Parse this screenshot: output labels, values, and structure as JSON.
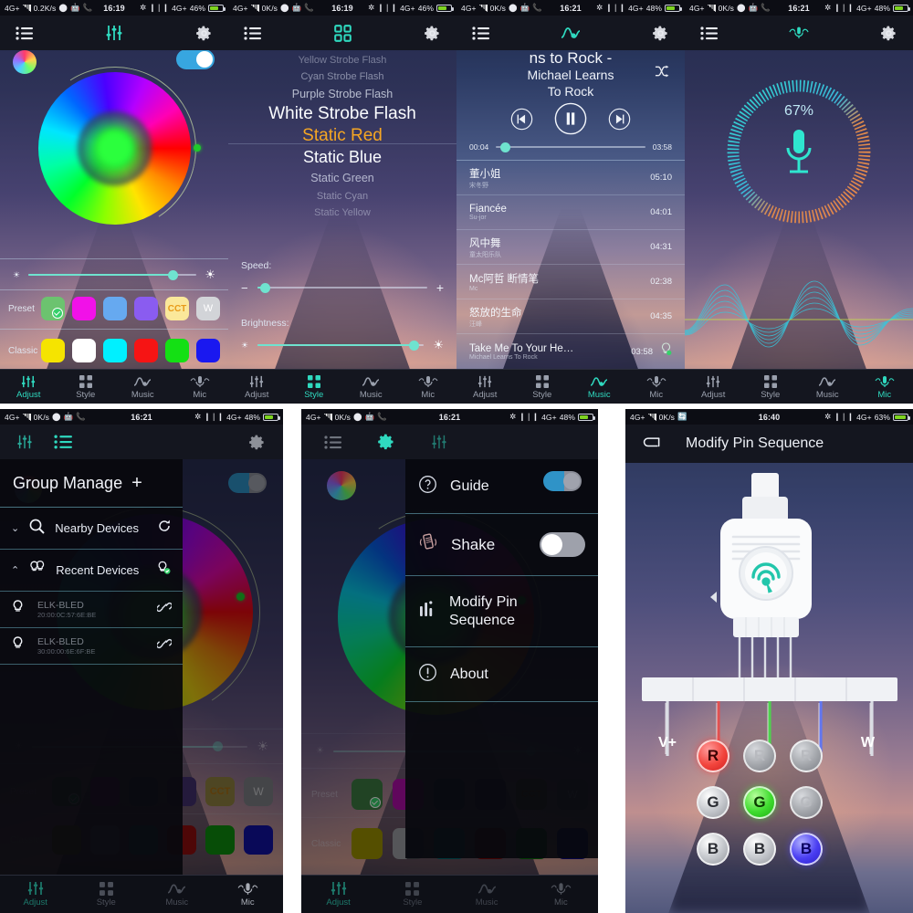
{
  "panels": {
    "adjust": {
      "status": {
        "left": "4G+",
        "speed": "0.2K/s",
        "time": "16:19",
        "net": "4G+",
        "battery": "46%"
      },
      "nav_active": "Adjust",
      "toggle_on": true,
      "brightness_pct": 86,
      "preset_label": "Preset",
      "classic_label": "Classic",
      "preset_swatches": [
        {
          "name": "green",
          "color": "#6cc36f",
          "selected": true,
          "text": ""
        },
        {
          "name": "magenta",
          "color": "#f111e8",
          "selected": false,
          "text": ""
        },
        {
          "name": "blue",
          "color": "#66a9f0",
          "selected": false,
          "text": ""
        },
        {
          "name": "purple",
          "color": "#8a5cf0",
          "selected": false,
          "text": ""
        },
        {
          "name": "cct",
          "color": "#fbe89a",
          "selected": false,
          "text": "CCT"
        },
        {
          "name": "white",
          "color": "#d2d4d8",
          "selected": false,
          "text": "W"
        }
      ],
      "classic_swatches": [
        {
          "name": "yellow",
          "color": "#f5e400"
        },
        {
          "name": "white",
          "color": "#ffffff"
        },
        {
          "name": "cyan",
          "color": "#00f0ff"
        },
        {
          "name": "red",
          "color": "#f61414"
        },
        {
          "name": "green",
          "color": "#14e014"
        },
        {
          "name": "blue",
          "color": "#1a18f0"
        }
      ]
    },
    "style": {
      "status": {
        "left": "4G+",
        "speed": "0K/s",
        "time": "16:19",
        "net": "4G+",
        "battery": "46%"
      },
      "nav_active": "Style",
      "modes": [
        {
          "label": "Yellow Strobe Flash",
          "state": "far"
        },
        {
          "label": "Cyan Strobe Flash",
          "state": "far"
        },
        {
          "label": "Purple Strobe Flash",
          "state": "near"
        },
        {
          "label": "White Strobe Flash",
          "state": "big"
        },
        {
          "label": "Static Red",
          "state": "selected"
        },
        {
          "label": "Static Blue",
          "state": "big"
        },
        {
          "label": "Static Green",
          "state": "near"
        },
        {
          "label": "Static Cyan",
          "state": "far"
        },
        {
          "label": "Static Yellow",
          "state": "far"
        }
      ],
      "speed_label": "Speed:",
      "speed_pct": 5,
      "brightness_label": "Brightness:",
      "brightness_pct": 94,
      "minus": "−",
      "plus": "+"
    },
    "music": {
      "status": {
        "left": "4G+",
        "speed": "0K/s",
        "time": "16:21",
        "net": "4G+",
        "battery": "48%"
      },
      "nav_active": "Music",
      "now_title": "ns to Rock -",
      "now_artist": "Michael Learns\nTo Rock",
      "elapsed": "00:04",
      "duration": "03:58",
      "progress_pct": 6,
      "tracks": [
        {
          "title": "董小姐",
          "artist": "宋冬野",
          "time": "05:10"
        },
        {
          "title": "Fiancée",
          "artist": "Su-jor",
          "time": "04:01"
        },
        {
          "title": "风中舞",
          "artist": "童太阳乐队",
          "time": "04:31"
        },
        {
          "title": "Mc阿哲 断情笔",
          "artist": "Mc",
          "time": "02:38"
        },
        {
          "title": "怒放的生命",
          "artist": "汪峰",
          "time": "04:35"
        },
        {
          "title": "Take Me To Your He…",
          "artist": "Michael Learns To Rock",
          "time": "03:58"
        }
      ]
    },
    "mic": {
      "status": {
        "left": "4G+",
        "speed": "0K/s",
        "time": "16:21",
        "net": "4G+",
        "battery": "48%"
      },
      "nav_active": "Mic",
      "sensitivity": "67%"
    },
    "group": {
      "status": {
        "left": "4G+",
        "speed": "0K/s",
        "time": "16:21",
        "net": "4G+",
        "battery": "48%"
      },
      "nav_active": "Adjust",
      "title": "Group Manage",
      "add": "+",
      "sections": [
        {
          "name": "nearby",
          "label": "Nearby Devices",
          "icon": "search-icon",
          "action": "refresh-icon",
          "expanded": false
        },
        {
          "name": "recent",
          "label": "Recent Devices",
          "icon": "bulbs-icon",
          "action": "bulb-check-icon",
          "expanded": true
        }
      ],
      "devices": [
        {
          "name": "ELK-BLED",
          "mac": "20:00:0C:57:6E:BE"
        },
        {
          "name": "ELK-BLED",
          "mac": "30:00:00:6E:6F:BE"
        }
      ]
    },
    "settings": {
      "status": {
        "left": "4G+",
        "speed": "0K/s",
        "time": "16:21",
        "net": "4G+",
        "battery": "48%"
      },
      "nav_active": "Adjust",
      "items": [
        {
          "label": "Guide",
          "icon": "question-circle-icon",
          "control": "none"
        },
        {
          "label": "Shake",
          "icon": "shake-icon",
          "control": "toggle-off"
        },
        {
          "label": "Modify Pin\nSequence",
          "icon": "pin-bars-icon",
          "control": "none"
        },
        {
          "label": "About",
          "icon": "exclamation-circle-icon",
          "control": "none"
        }
      ]
    },
    "pin": {
      "status": {
        "left": "4G+",
        "speed": "0K/s",
        "time": "16:40",
        "net": "4G+",
        "battery": "63%"
      },
      "title": "Modify Pin Sequence",
      "back": "back-icon",
      "left_label": "V+",
      "right_label": "W",
      "grid": [
        [
          {
            "letter": "R",
            "state": "active-red"
          },
          {
            "letter": "R",
            "state": "dim"
          },
          {
            "letter": "R",
            "state": "dim"
          }
        ],
        [
          {
            "letter": "G",
            "state": "off"
          },
          {
            "letter": "G",
            "state": "active-green"
          },
          {
            "letter": "G",
            "state": "dim"
          }
        ],
        [
          {
            "letter": "B",
            "state": "off"
          },
          {
            "letter": "B",
            "state": "off"
          },
          {
            "letter": "B",
            "state": "active-blue"
          }
        ]
      ],
      "wire_colors": [
        "#d8dade",
        "#e03a3a",
        "#3fd33f",
        "#4a6bf0",
        "#d8dade"
      ]
    }
  },
  "nav": {
    "items": [
      {
        "label": "Adjust",
        "icon": "sliders-icon"
      },
      {
        "label": "Style",
        "icon": "grid-icon"
      },
      {
        "label": "Music",
        "icon": "music-wave-icon"
      },
      {
        "label": "Mic",
        "icon": "mic-icon"
      }
    ]
  },
  "colors": {
    "accent": "#2fd9bf",
    "selected": "#f5a623",
    "toggle_on": "#37a6e0"
  }
}
